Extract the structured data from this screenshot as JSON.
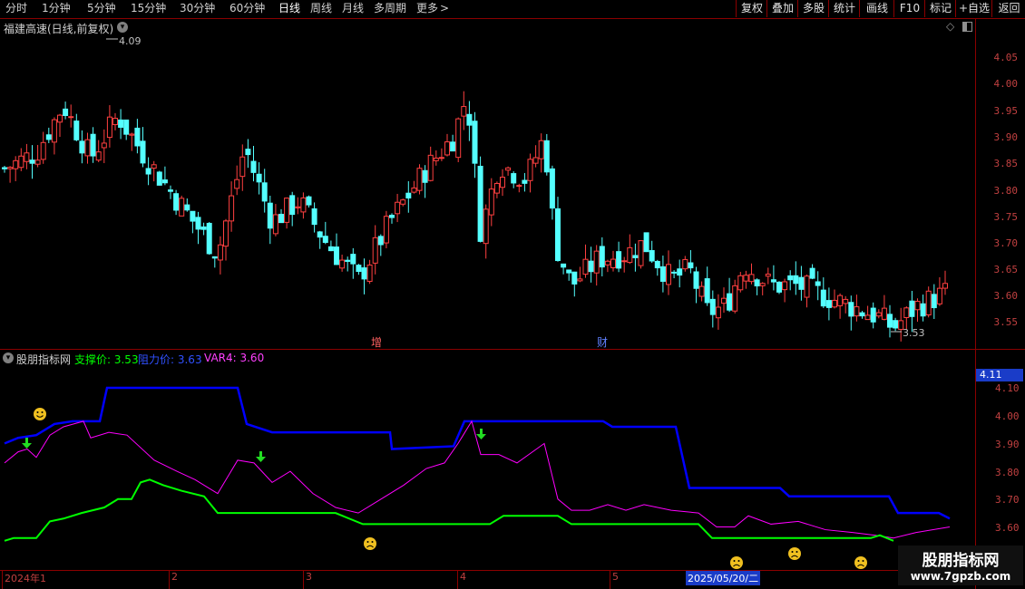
{
  "toolbar": {
    "left_items": [
      "分时",
      "1分钟",
      "5分钟",
      "15分钟",
      "30分钟",
      "60分钟",
      "日线",
      "周线",
      "月线",
      "多周期",
      "更多"
    ],
    "more_arrow": ">",
    "right_items": [
      "复权",
      "叠加",
      "多股",
      "统计",
      "画线",
      "F10",
      "标记",
      "+自选",
      "返回"
    ]
  },
  "main_panel": {
    "title": "福建高速(日线,前复权)",
    "high_label": "4.09",
    "low_label": "3.53",
    "marker_zeng": "增",
    "marker_cai": "财",
    "price_axis": [
      "4.05",
      "4.00",
      "3.95",
      "3.90",
      "3.85",
      "3.80",
      "3.75",
      "3.70",
      "3.65",
      "3.60",
      "3.55"
    ],
    "colors": {
      "up": "#ff4040",
      "down": "#54ffff"
    }
  },
  "indicator_panel": {
    "name": "股朋指标网",
    "support_label": "支撑价: 3.53",
    "resist_label": "阻力价: 3.63",
    "var4_label": "VAR4: 3.60",
    "price_tag": "4.11",
    "axis": [
      "4.10",
      "4.00",
      "3.90",
      "3.80",
      "3.70",
      "3.60"
    ],
    "colors": {
      "support": "#00ff00",
      "resist": "#0000ff",
      "var4": "#ff00ff"
    }
  },
  "dates": [
    "2024年1",
    "2",
    "3",
    "4",
    "5",
    "2025/05/20/二"
  ],
  "watermark": {
    "title": "股朋指标网",
    "url": "www.7gpzb.com"
  }
}
